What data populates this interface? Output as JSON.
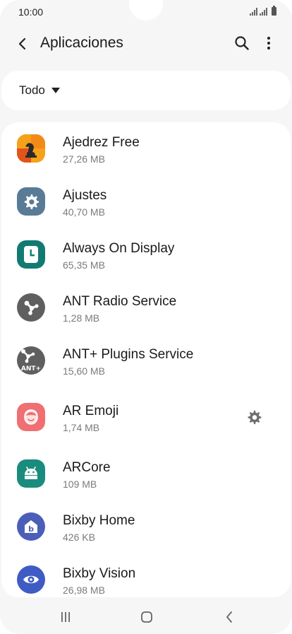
{
  "status_bar": {
    "time": "10:00"
  },
  "header": {
    "title": "Aplicaciones",
    "back_icon": "back-arrow-icon",
    "search_icon": "search-icon",
    "more_icon": "more-vertical-icon"
  },
  "filter": {
    "label": "Todo"
  },
  "apps": [
    {
      "name": "Ajedrez Free",
      "size": "27,26 MB",
      "icon": "chess-icon",
      "color": "#f7a21b"
    },
    {
      "name": "Ajustes",
      "size": "40,70 MB",
      "icon": "gear-icon",
      "color": "#5a7b96"
    },
    {
      "name": "Always On Display",
      "size": "65,35 MB",
      "icon": "clock-icon",
      "color": "#127a72"
    },
    {
      "name": "ANT Radio Service",
      "size": "1,28 MB",
      "icon": "ant-radio-icon",
      "color": "#5f5f5f"
    },
    {
      "name": "ANT+ Plugins Service",
      "size": "15,60 MB",
      "icon": "ant-plus-icon",
      "color": "#5f5f5f",
      "icon_text": "ANT+"
    },
    {
      "name": "AR Emoji",
      "size": "1,74 MB",
      "icon": "ar-emoji-icon",
      "color": "#ef6f73",
      "has_settings": true
    },
    {
      "name": "ARCore",
      "size": "109 MB",
      "icon": "android-icon",
      "color": "#1a8c7e"
    },
    {
      "name": "Bixby Home",
      "size": "426 KB",
      "icon": "bixby-home-icon",
      "color": "#4b5fb8"
    },
    {
      "name": "Bixby Vision",
      "size": "26,98 MB",
      "icon": "bixby-vision-icon",
      "color": "#3f5bc4"
    }
  ],
  "navbar": {
    "recents_icon": "recents-icon",
    "home_icon": "home-icon",
    "back_icon": "nav-back-icon"
  }
}
